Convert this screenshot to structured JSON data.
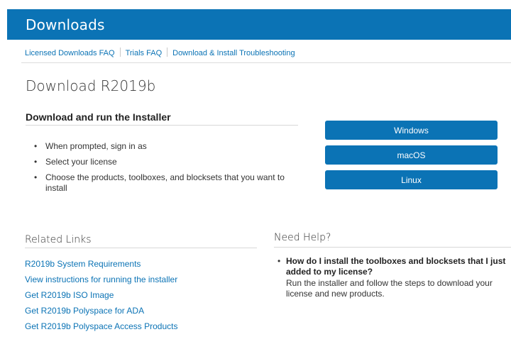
{
  "header": {
    "title": "Downloads"
  },
  "subnav": [
    "Licensed Downloads FAQ",
    "Trials FAQ",
    "Download & Install Troubleshooting"
  ],
  "page": {
    "title": "Download R2019b"
  },
  "installer": {
    "heading": "Download and run the Installer",
    "steps": [
      "When prompted, sign in as",
      "Select your license",
      "Choose the products, toolboxes, and blocksets that you want to install"
    ]
  },
  "downloads": {
    "windows": "Windows",
    "macos": "macOS",
    "linux": "Linux"
  },
  "related": {
    "heading": "Related Links",
    "links": [
      "R2019b System Requirements",
      "View instructions for running the installer",
      "Get R2019b ISO Image",
      "Get R2019b Polyspace for ADA",
      "Get R2019b Polyspace Access Products"
    ]
  },
  "help": {
    "heading": "Need Help?",
    "question": "How do I install the toolboxes and blocksets that I just added to my license?",
    "answer": "Run the installer and follow the steps to download your license and new products."
  },
  "colors": {
    "brand": "#0b73b5",
    "link": "#0b73b5"
  },
  "icons": {
    "bullet": "•"
  }
}
